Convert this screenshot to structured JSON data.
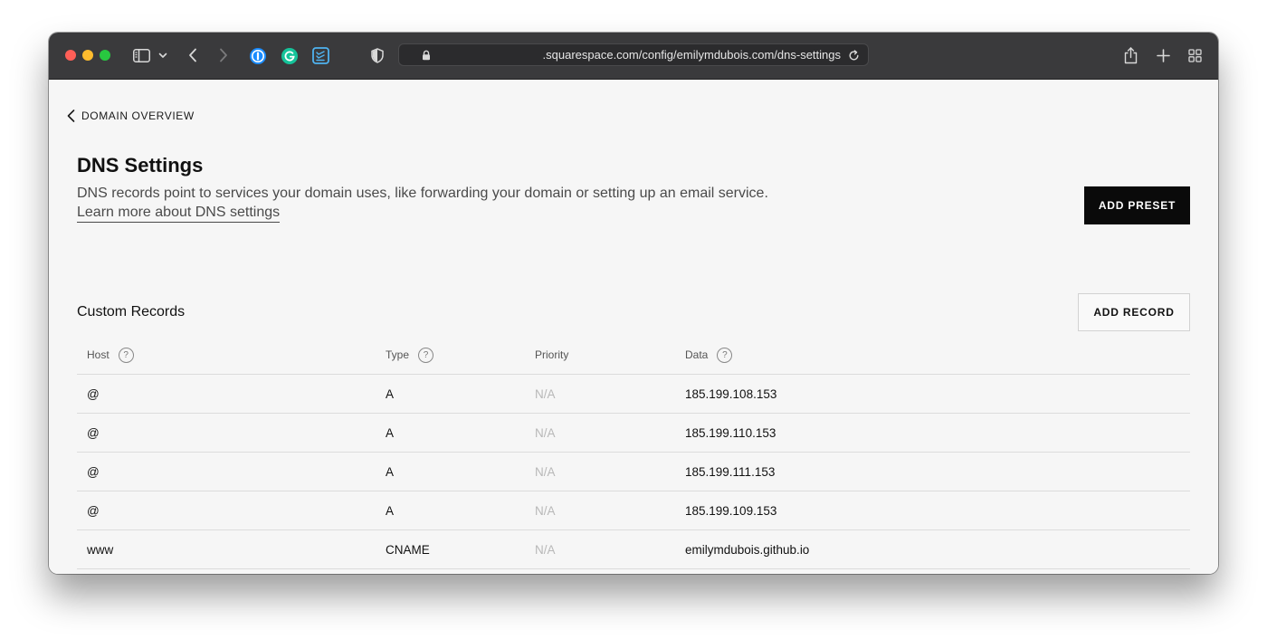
{
  "browser": {
    "url": ".squarespace.com/config/emilymdubois.com/dns-settings"
  },
  "nav": {
    "back_label": "DOMAIN OVERVIEW"
  },
  "page": {
    "title": "DNS Settings",
    "description": "DNS records point to services your domain uses, like forwarding your domain or setting up an email service.",
    "learn_more": "Learn more about DNS settings",
    "add_preset_label": "ADD PRESET"
  },
  "custom_records": {
    "title": "Custom Records",
    "add_record_label": "ADD RECORD",
    "columns": {
      "host": "Host",
      "type": "Type",
      "priority": "Priority",
      "data": "Data"
    },
    "help_glyph": "?",
    "rows": [
      {
        "host": "@",
        "type": "A",
        "priority": "N/A",
        "data": "185.199.108.153"
      },
      {
        "host": "@",
        "type": "A",
        "priority": "N/A",
        "data": "185.199.110.153"
      },
      {
        "host": "@",
        "type": "A",
        "priority": "N/A",
        "data": "185.199.111.153"
      },
      {
        "host": "@",
        "type": "A",
        "priority": "N/A",
        "data": "185.199.109.153"
      },
      {
        "host": "www",
        "type": "CNAME",
        "priority": "N/A",
        "data": "emilymdubois.github.io"
      }
    ]
  },
  "colors": {
    "titlebar": "#3a3a3c",
    "page_bg": "#f6f6f6",
    "primary_button": "#0a0a0a",
    "traffic_red": "#ff5f57",
    "traffic_yellow": "#febc2e",
    "traffic_green": "#28c840",
    "onepassword_blue": "#1a8cff",
    "grammarly_green": "#15c39a"
  },
  "toolbar_icons": [
    "sidebar-icon",
    "chevron-down-icon",
    "back-arrow-icon",
    "forward-arrow-icon",
    "onepassword-icon",
    "grammarly-icon",
    "notes-extension-icon",
    "shield-icon",
    "lock-icon",
    "reload-icon",
    "share-icon",
    "new-tab-icon",
    "tab-overview-icon"
  ]
}
